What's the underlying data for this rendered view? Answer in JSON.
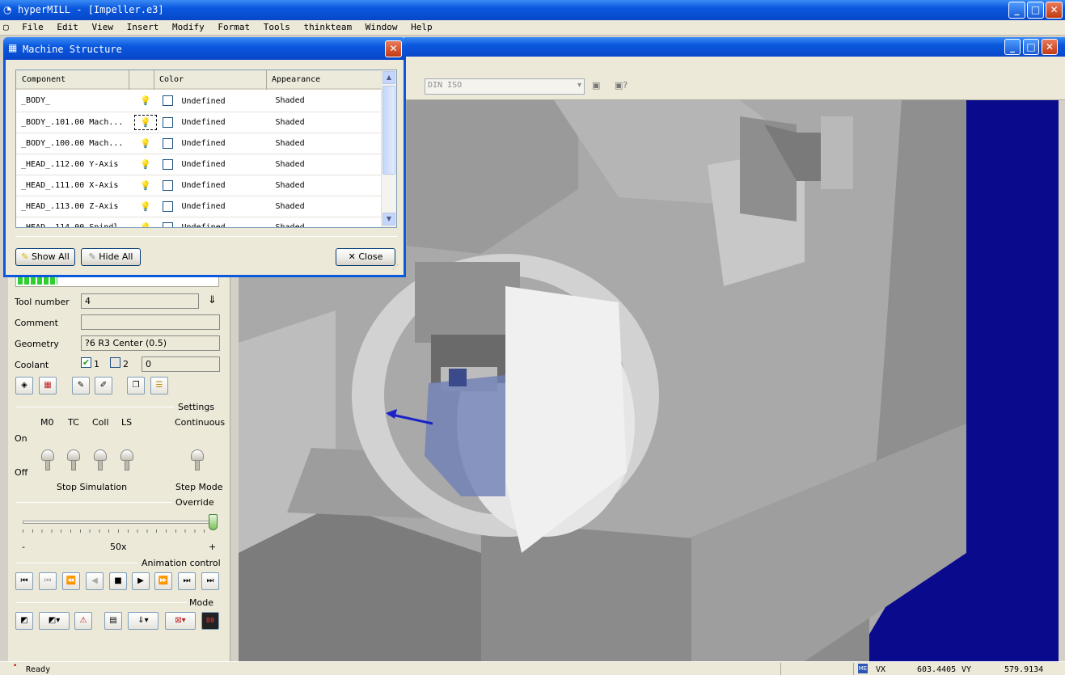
{
  "app": {
    "title": "hyperMILL - [Impeller.e3]",
    "menu": [
      "File",
      "Edit",
      "View",
      "Insert",
      "Modify",
      "Format",
      "Tools",
      "thinkteam",
      "Window",
      "Help"
    ]
  },
  "toolbar": {
    "postprocessor_select": "DIN ISO"
  },
  "dialog": {
    "title": "Machine Structure",
    "columns": [
      "Component",
      "",
      "Color",
      "Appearance"
    ],
    "rows": [
      {
        "component": "_BODY_",
        "color": "Undefined",
        "appearance": "Shaded",
        "bulb": "off"
      },
      {
        "component": "_BODY_.101.00 Mach...",
        "color": "Undefined",
        "appearance": "Shaded",
        "bulb": "off"
      },
      {
        "component": "_BODY_.100.00 Mach...",
        "color": "Undefined",
        "appearance": "Shaded",
        "bulb": "on"
      },
      {
        "component": "_HEAD_.112.00 Y-Axis",
        "color": "Undefined",
        "appearance": "Shaded",
        "bulb": "on"
      },
      {
        "component": "_HEAD_.111.00 X-Axis",
        "color": "Undefined",
        "appearance": "Shaded",
        "bulb": "on"
      },
      {
        "component": "_HEAD_.113.00 Z-Axis",
        "color": "Undefined",
        "appearance": "Shaded",
        "bulb": "on"
      },
      {
        "component": "_HEAD_.114.00 Spindl...",
        "color": "Undefined",
        "appearance": "Shaded",
        "bulb": "on"
      }
    ],
    "show_all": "Show All",
    "hide_all": "Hide All",
    "close": "Close"
  },
  "panel": {
    "progress": 0.2,
    "tool_number_label": "Tool number",
    "tool_number": "4",
    "comment_label": "Comment",
    "comment": "",
    "geometry_label": "Geometry",
    "geometry": "?6  R3  Center  (0.5)",
    "coolant_label": "Coolant",
    "coolant_1": "1",
    "coolant_2": "2",
    "coolant_value": "0",
    "settings_label": "Settings",
    "cols": [
      "M0",
      "TC",
      "Coll",
      "LS"
    ],
    "continuous": "Continuous",
    "on": "On",
    "off": "Off",
    "stop_simulation": "Stop Simulation",
    "step_mode": "Step Mode",
    "override_label": "Override",
    "override_min": "-",
    "override_value": "50x",
    "override_max": "+",
    "override_level": 1.0,
    "animation_label": "Animation control",
    "mode_label": "Mode"
  },
  "status": {
    "ready": "Ready",
    "vx_label": "VX",
    "vx": "603.4405",
    "vy_label": "VY",
    "vy": "579.9134"
  },
  "colors": {
    "accent": "#0a58de",
    "viewport_bg": "#00008b",
    "machine_grey": "#a8a8a8"
  }
}
